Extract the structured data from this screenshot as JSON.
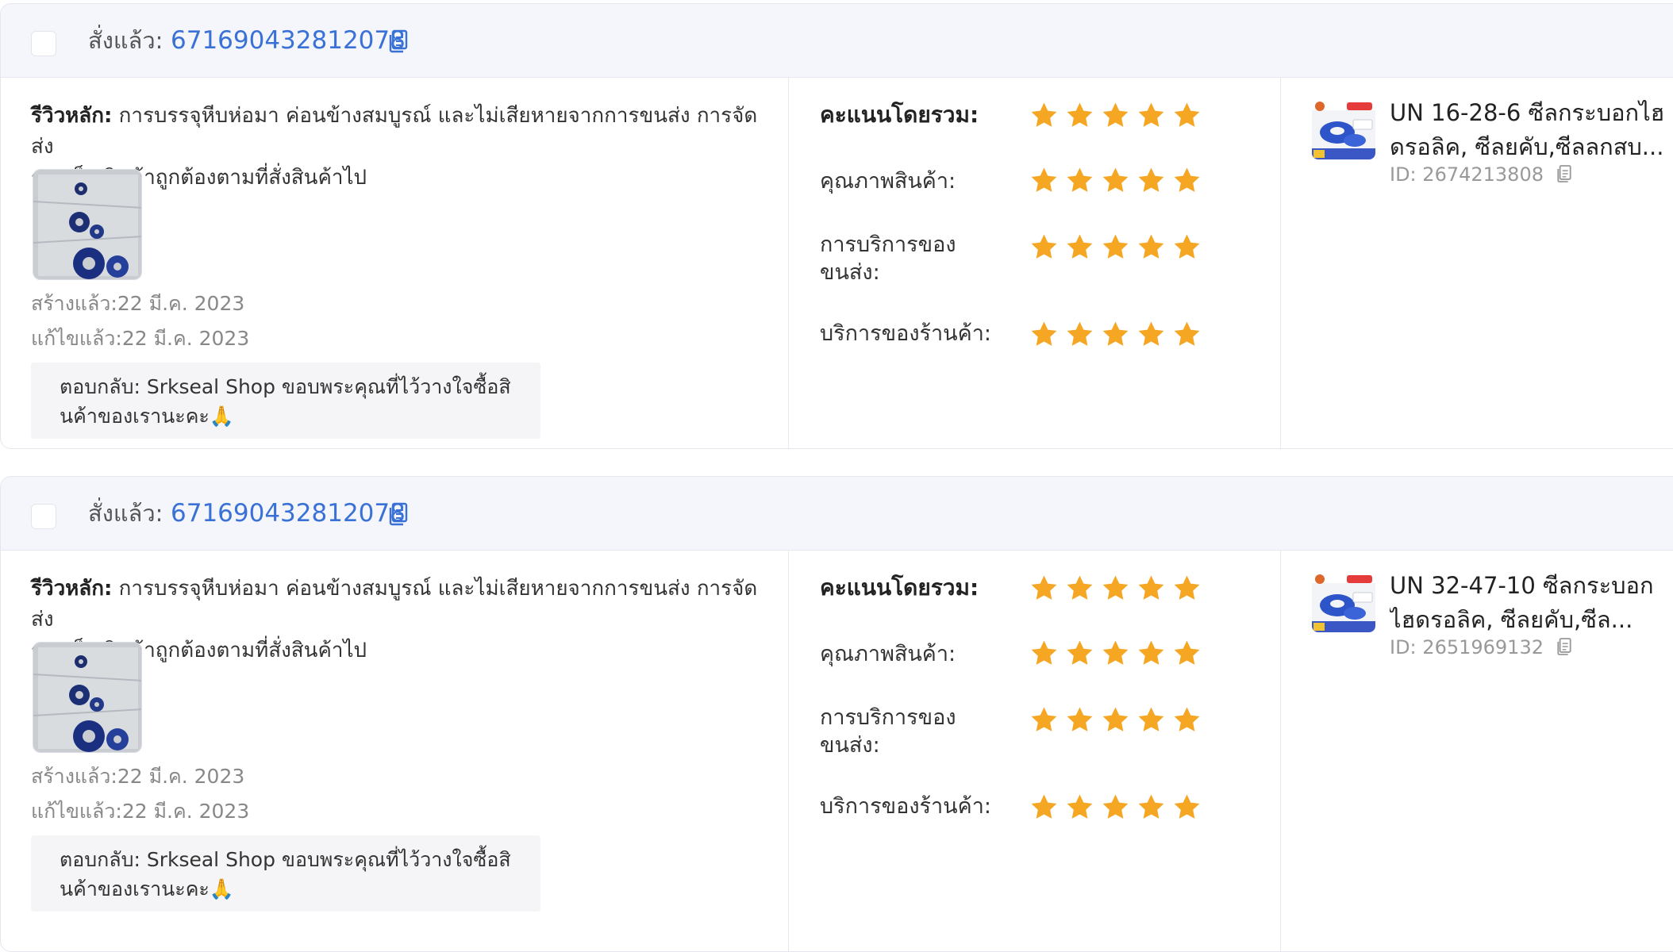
{
  "labels": {
    "ordered": "สั่งแล้ว:",
    "main_review": "รีวิวหลัก:",
    "overall": "คะแนนโดยรวม:",
    "quality": "คุณภาพสินค้า:",
    "shipping_line1": "การบริการของ",
    "shipping_line2": "ขนส่ง:",
    "shop_service": "บริการของร้านค้า:",
    "created_prefix": "สร้างแล้ว:",
    "edited_prefix": "แก้ไขแล้ว:",
    "reply_prefix": "ตอบกลับ:",
    "id_prefix": "ID:"
  },
  "colors": {
    "accent": "#3a71d6",
    "star": "#f5a623",
    "header_bg": "#f4f6fb"
  },
  "reviews": [
    {
      "order_id": "671690432812078",
      "review_line1": "การบรรจุหีบห่อมา ค่อนข้างสมบูรณ์ และไม่เสียหายจากการขนส่ง การจัดส่ง",
      "review_line2": "รวดเร็ว สินค้าถูกต้องตามที่สั่งสินค้าไป",
      "created_date": "22 มี.ค. 2023",
      "edited_date": "22 มี.ค. 2023",
      "reply_line1": "Srkseal Shop ขอบพระคุณที่ไว้วางใจซื้อสิ",
      "reply_line2": "นค้าของเรานะคะ🙏",
      "ratings": {
        "overall": 5,
        "quality": 5,
        "shipping": 5,
        "shop_service": 5
      },
      "product_title_line1": "UN 16-28-6 ซีลกระบอกไฮ",
      "product_title_line2": "ดรอลิค, ซีลยคับ,ซีลลกสบ...",
      "product_id": "2674213808"
    },
    {
      "order_id": "671690432812078",
      "review_line1": "การบรรจุหีบห่อมา ค่อนข้างสมบูรณ์ และไม่เสียหายจากการขนส่ง การจัดส่ง",
      "review_line2": "รวดเร็ว สินค้าถูกต้องตามที่สั่งสินค้าไป",
      "created_date": "22 มี.ค. 2023",
      "edited_date": "22 มี.ค. 2023",
      "reply_line1": "Srkseal Shop ขอบพระคุณที่ไว้วางใจซื้อสิ",
      "reply_line2": "นค้าของเรานะคะ🙏",
      "ratings": {
        "overall": 5,
        "quality": 5,
        "shipping": 5,
        "shop_service": 5
      },
      "product_title_line1": "UN 32-47-10 ซีลกระบอก",
      "product_title_line2": "ไฮดรอลิค, ซีลยคับ,ซีล...",
      "product_id": "2651969132"
    }
  ],
  "icons": {
    "copy": "copy-icon",
    "star": "star-icon",
    "checkbox": "checkbox"
  }
}
